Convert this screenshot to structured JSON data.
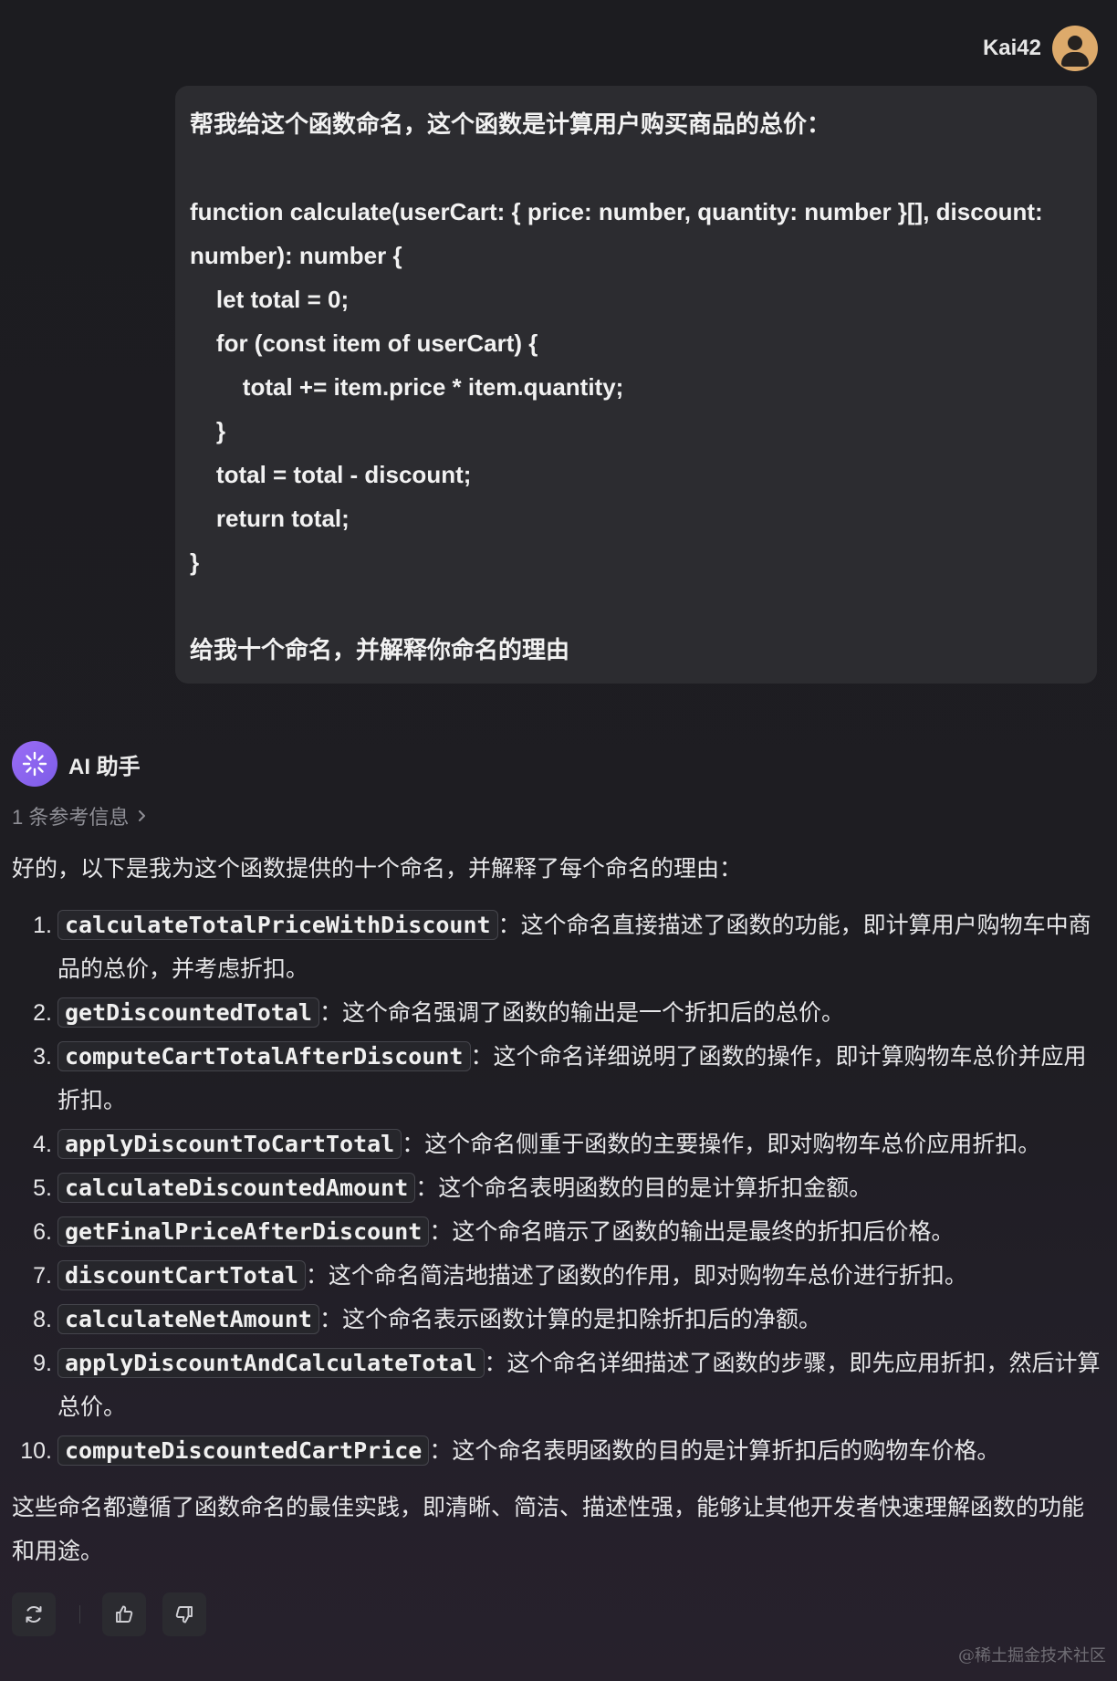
{
  "user": {
    "name": "Kai42",
    "message_lines": [
      "帮我给这个函数命名，这个函数是计算用户购买商品的总价：",
      "",
      "function calculate(userCart: { price: number, quantity: number }[], discount:",
      "number): number {",
      "    let total = 0;",
      "    for (const item of userCart) {",
      "        total += item.price * item.quantity;",
      "    }",
      "    total = total - discount;",
      "    return total;",
      "}",
      "",
      "给我十个命名，并解释你命名的理由"
    ]
  },
  "assistant": {
    "name": "AI 助手",
    "reference_label": "1 条参考信息",
    "intro": "好的，以下是我为这个函数提供的十个命名，并解释了每个命名的理由：",
    "items": [
      {
        "num": "1.",
        "name": "calculateTotalPriceWithDiscount",
        "text": "：这个命名直接描述了函数的功能，即计算用户购物车中商品的总价，并考虑折扣。"
      },
      {
        "num": "2.",
        "name": "getDiscountedTotal",
        "text": "：这个命名强调了函数的输出是一个折扣后的总价。"
      },
      {
        "num": "3.",
        "name": "computeCartTotalAfterDiscount",
        "text": "：这个命名详细说明了函数的操作，即计算购物车总价并应用折扣。"
      },
      {
        "num": "4.",
        "name": "applyDiscountToCartTotal",
        "text": "：这个命名侧重于函数的主要操作，即对购物车总价应用折扣。"
      },
      {
        "num": "5.",
        "name": "calculateDiscountedAmount",
        "text": "：这个命名表明函数的目的是计算折扣金额。"
      },
      {
        "num": "6.",
        "name": "getFinalPriceAfterDiscount",
        "text": "：这个命名暗示了函数的输出是最终的折扣后价格。"
      },
      {
        "num": "7.",
        "name": "discountCartTotal",
        "text": "：这个命名简洁地描述了函数的作用，即对购物车总价进行折扣。"
      },
      {
        "num": "8.",
        "name": "calculateNetAmount",
        "text": "：这个命名表示函数计算的是扣除折扣后的净额。"
      },
      {
        "num": "9.",
        "name": "applyDiscountAndCalculateTotal",
        "text": "：这个命名详细描述了函数的步骤，即先应用折扣，然后计算总价。"
      },
      {
        "num": "10.",
        "name": "computeDiscountedCartPrice",
        "text": "：这个命名表明函数的目的是计算折扣后的购物车价格。"
      }
    ],
    "outro": "这些命名都遵循了函数命名的最佳实践，即清晰、简洁、描述性强，能够让其他开发者快速理解函数的功能和用途。"
  },
  "actions": {
    "icons": [
      "refresh-icon",
      "thumbs-up-icon",
      "thumbs-down-icon"
    ]
  },
  "watermark": "@稀土掘金技术社区",
  "colors": {
    "background": "#1c1c20",
    "bubble": "#2c2c30",
    "user_avatar": "#ddaa6b",
    "ai_avatar": "#8b64f0"
  }
}
